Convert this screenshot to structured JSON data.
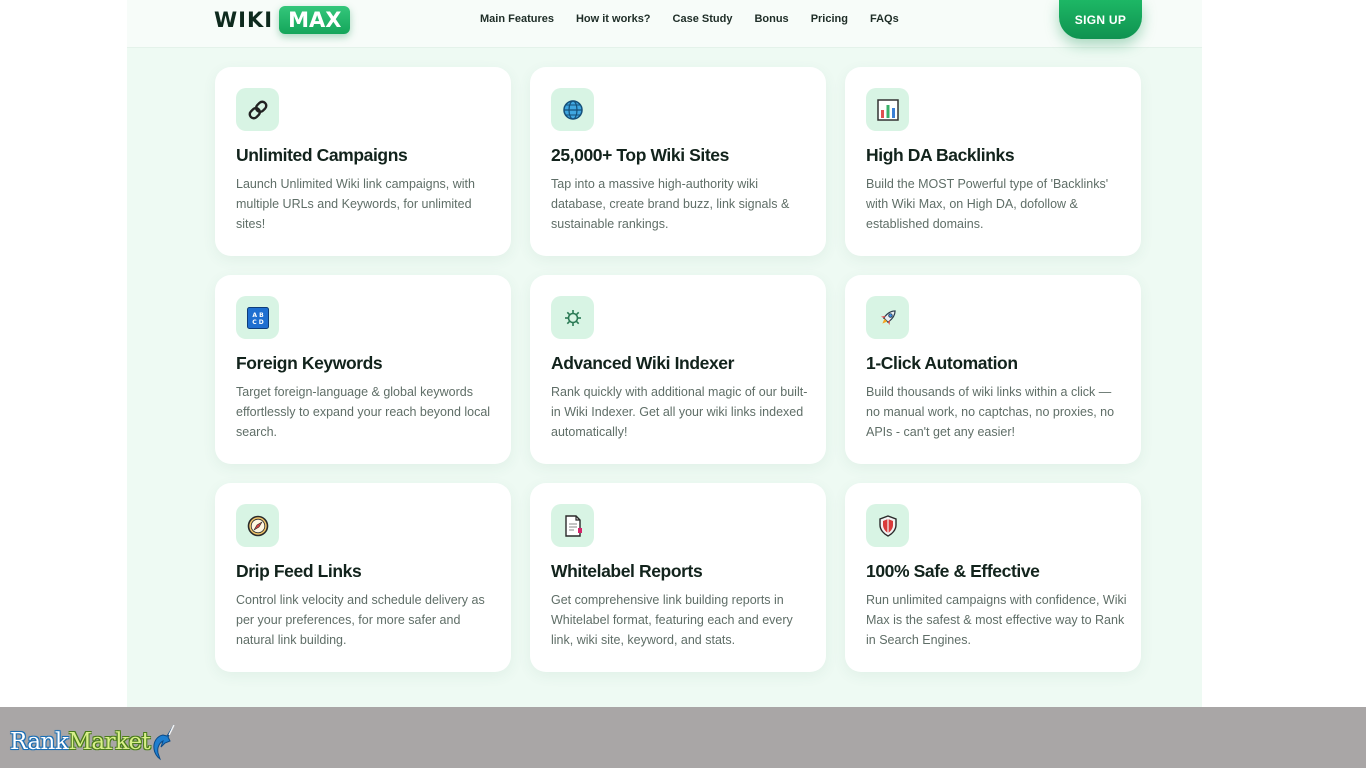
{
  "header": {
    "logo_wiki": "WIKI",
    "logo_max": "MAX",
    "nav": [
      "Main Features",
      "How it works?",
      "Case Study",
      "Bonus",
      "Pricing",
      "FAQs"
    ],
    "signup_label": "SIGN UP"
  },
  "features": [
    {
      "icon": "link-icon",
      "title": "Unlimited Campaigns",
      "desc": "Launch Unlimited Wiki link campaigns, with multiple URLs and Keywords, for unlimited sites!"
    },
    {
      "icon": "globe-icon",
      "title": "25,000+ Top Wiki Sites",
      "desc": "Tap into a massive high-authority wiki database, create brand buzz, link signals & sustainable rankings."
    },
    {
      "icon": "bar-chart-icon",
      "title": "High DA Backlinks",
      "desc": "Build the MOST Powerful type of 'Backlinks' with Wiki Max, on High DA, dofollow & established domains."
    },
    {
      "icon": "abcd-icon",
      "title": "Foreign Keywords",
      "desc": "Target foreign-language & global keywords effortlessly to expand your reach beyond local search."
    },
    {
      "icon": "gear-icon",
      "title": "Advanced Wiki Indexer",
      "desc": "Rank quickly with additional magic of our built-in Wiki Indexer. Get all your wiki links indexed automatically!"
    },
    {
      "icon": "rocket-icon",
      "title": "1-Click Automation",
      "desc": "Build thousands of wiki links within a click — no manual work, no captchas, no proxies, no APIs - can't get any easier!"
    },
    {
      "icon": "compass-icon",
      "title": "Drip Feed Links",
      "desc": "Control link velocity and schedule delivery as per your preferences, for more safer and natural link building."
    },
    {
      "icon": "report-icon",
      "title": "Whitelabel Reports",
      "desc": "Get comprehensive link building reports in Whitelabel format, featuring each and every link, wiki site, keyword, and stats."
    },
    {
      "icon": "shield-icon",
      "title": "100% Safe & Effective",
      "desc": "Run unlimited campaigns with confidence, Wiki Max is the safest & most effective way to Rank in Search Engines."
    }
  ],
  "watermark": {
    "part1": "Rank",
    "part2": "Market"
  },
  "colors": {
    "accent": "#14a55a",
    "panel_bg": "#eefaf3",
    "icon_bg": "#d8f4e4",
    "footer_bar": "#a9a6a6"
  }
}
